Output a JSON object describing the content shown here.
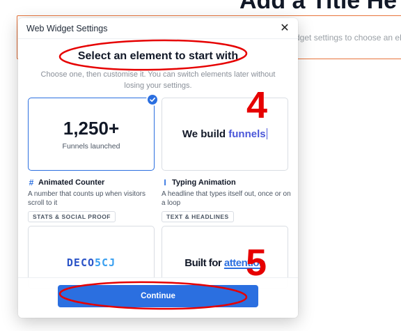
{
  "background": {
    "page_title": "Add a Title He",
    "hint_text": "dget settings to choose an el"
  },
  "modal": {
    "title": "Web Widget Settings",
    "close_glyph": "✕",
    "heading": "Select an element to start with",
    "subtitle": "Choose one, then customise it. You can switch elements later without losing your settings.",
    "continue_label": "Continue"
  },
  "cards": [
    {
      "name": "Animated Counter",
      "icon": "hash-icon",
      "icon_glyph": "#",
      "preview_value": "1,250+",
      "preview_caption": "Funnels launched",
      "description": "A number that counts up when visitors scroll to it",
      "tag": "STATS & SOCIAL PROOF",
      "selected": true
    },
    {
      "name": "Typing Animation",
      "icon": "text-cursor-icon",
      "icon_glyph": "I",
      "preview_text": "We build ",
      "preview_accent": "funnels",
      "description": "A headline that types itself out, once or on a loop",
      "tag": "TEXT & HEADLINES",
      "selected": false
    },
    {
      "preview_text": "DECO",
      "preview_accent": "5CJ",
      "selected": false
    },
    {
      "preview_text": "Built for ",
      "preview_accent": "attention",
      "selected": false
    }
  ],
  "annotations": {
    "label_4": "4",
    "label_5": "5",
    "color": "#e60000"
  },
  "colors": {
    "accent": "#2b6fe0",
    "background_box_border": "#e8743b"
  }
}
